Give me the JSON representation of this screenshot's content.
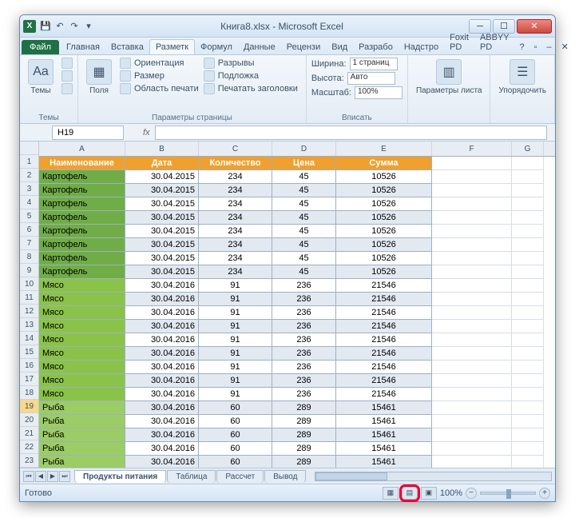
{
  "title": "Книга8.xlsx - Microsoft Excel",
  "qat": [
    "save",
    "undo",
    "redo",
    "down"
  ],
  "tabs": {
    "file": "Файл",
    "items": [
      "Главная",
      "Вставка",
      "Разметк",
      "Формул",
      "Данные",
      "Рецензи",
      "Вид",
      "Разрабо",
      "Надстро",
      "Foxit PD",
      "ABBYY PD"
    ],
    "active_index": 2
  },
  "ribbon": {
    "g1": {
      "themes": "Темы",
      "label": "Темы"
    },
    "g2": {
      "fields": "Поля",
      "orientation": "Ориентация",
      "size": "Размер",
      "printarea": "Область печати",
      "breaks": "Разрывы",
      "background": "Подложка",
      "printheaders": "Печатать заголовки",
      "label": "Параметры страницы"
    },
    "g3": {
      "width": "Ширина:",
      "width_v": "1 страниц",
      "height": "Высота:",
      "height_v": "Авто",
      "scale": "Масштаб:",
      "scale_v": "100%",
      "label": "Вписать"
    },
    "g4": {
      "sheetopts": "Параметры листа",
      "label": ""
    },
    "g5": {
      "arrange": "Упорядочить",
      "label": ""
    }
  },
  "namebox": "H19",
  "columns": [
    "A",
    "B",
    "C",
    "D",
    "E",
    "F",
    "G"
  ],
  "header_row": [
    "Наименование",
    "Дата",
    "Количество",
    "Цена",
    "Сумма"
  ],
  "rows": [
    {
      "n": "2",
      "name": "Картофель",
      "date": "30.04.2015",
      "qty": "234",
      "price": "45",
      "sum": "10526",
      "g": 1
    },
    {
      "n": "3",
      "name": "Картофель",
      "date": "30.04.2015",
      "qty": "234",
      "price": "45",
      "sum": "10526",
      "g": 1
    },
    {
      "n": "4",
      "name": "Картофель",
      "date": "30.04.2015",
      "qty": "234",
      "price": "45",
      "sum": "10526",
      "g": 1
    },
    {
      "n": "5",
      "name": "Картофель",
      "date": "30.04.2015",
      "qty": "234",
      "price": "45",
      "sum": "10526",
      "g": 1
    },
    {
      "n": "6",
      "name": "Картофель",
      "date": "30.04.2015",
      "qty": "234",
      "price": "45",
      "sum": "10526",
      "g": 1
    },
    {
      "n": "7",
      "name": "Картофель",
      "date": "30.04.2015",
      "qty": "234",
      "price": "45",
      "sum": "10526",
      "g": 1
    },
    {
      "n": "8",
      "name": "Картофель",
      "date": "30.04.2015",
      "qty": "234",
      "price": "45",
      "sum": "10526",
      "g": 1
    },
    {
      "n": "9",
      "name": "Картофель",
      "date": "30.04.2015",
      "qty": "234",
      "price": "45",
      "sum": "10526",
      "g": 1
    },
    {
      "n": "10",
      "name": "Мясо",
      "date": "30.04.2016",
      "qty": "91",
      "price": "236",
      "sum": "21546",
      "g": 2
    },
    {
      "n": "11",
      "name": "Мясо",
      "date": "30.04.2016",
      "qty": "91",
      "price": "236",
      "sum": "21546",
      "g": 2
    },
    {
      "n": "12",
      "name": "Мясо",
      "date": "30.04.2016",
      "qty": "91",
      "price": "236",
      "sum": "21546",
      "g": 2
    },
    {
      "n": "13",
      "name": "Мясо",
      "date": "30.04.2016",
      "qty": "91",
      "price": "236",
      "sum": "21546",
      "g": 2
    },
    {
      "n": "14",
      "name": "Мясо",
      "date": "30.04.2016",
      "qty": "91",
      "price": "236",
      "sum": "21546",
      "g": 2
    },
    {
      "n": "15",
      "name": "Мясо",
      "date": "30.04.2016",
      "qty": "91",
      "price": "236",
      "sum": "21546",
      "g": 2
    },
    {
      "n": "16",
      "name": "Мясо",
      "date": "30.04.2016",
      "qty": "91",
      "price": "236",
      "sum": "21546",
      "g": 2
    },
    {
      "n": "17",
      "name": "Мясо",
      "date": "30.04.2016",
      "qty": "91",
      "price": "236",
      "sum": "21546",
      "g": 2
    },
    {
      "n": "18",
      "name": "Мясо",
      "date": "30.04.2016",
      "qty": "91",
      "price": "236",
      "sum": "21546",
      "g": 2
    },
    {
      "n": "19",
      "name": "Рыба",
      "date": "30.04.2016",
      "qty": "60",
      "price": "289",
      "sum": "15461",
      "g": 3,
      "sel": true
    },
    {
      "n": "20",
      "name": "Рыба",
      "date": "30.04.2016",
      "qty": "60",
      "price": "289",
      "sum": "15461",
      "g": 3
    },
    {
      "n": "21",
      "name": "Рыба",
      "date": "30.04.2016",
      "qty": "60",
      "price": "289",
      "sum": "15461",
      "g": 3
    },
    {
      "n": "22",
      "name": "Рыба",
      "date": "30.04.2016",
      "qty": "60",
      "price": "289",
      "sum": "15461",
      "g": 3
    },
    {
      "n": "23",
      "name": "Рыба",
      "date": "30.04.2016",
      "qty": "60",
      "price": "289",
      "sum": "15461",
      "g": 3
    }
  ],
  "sheets": {
    "items": [
      "Продукты питания",
      "Таблица",
      "Рассчет",
      "Вывод"
    ],
    "active_index": 0
  },
  "status": {
    "ready": "Готово",
    "zoom": "100%"
  }
}
